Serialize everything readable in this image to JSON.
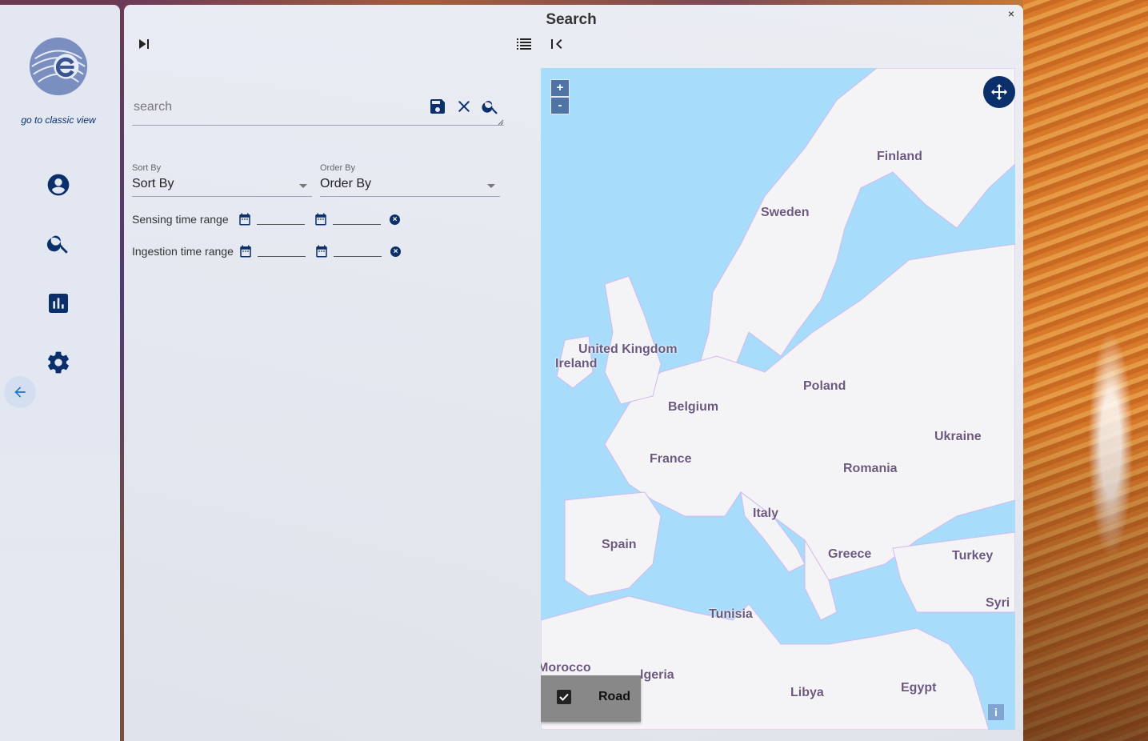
{
  "sidebar": {
    "classic_link": "go to classic view",
    "nav_items": [
      {
        "name": "account",
        "icon": "account-circle-icon"
      },
      {
        "name": "search",
        "icon": "search-icon"
      },
      {
        "name": "statistics",
        "icon": "bar-chart-icon"
      },
      {
        "name": "settings",
        "icon": "gear-icon"
      }
    ],
    "back_icon": "arrow-left-icon"
  },
  "panel": {
    "title": "Search",
    "close_label": "×"
  },
  "search": {
    "placeholder": "search",
    "value": ""
  },
  "sort": {
    "sort_by_label": "Sort By",
    "sort_by_value": "Sort By",
    "order_by_label": "Order By",
    "order_by_value": "Order By"
  },
  "ranges": {
    "sensing_label": "Sensing time range",
    "ingestion_label": "Ingestion time range"
  },
  "map": {
    "zoom_in": "+",
    "zoom_out": "-",
    "labels": {
      "finland": "Finland",
      "sweden": "Sweden",
      "uk": "United Kingdom",
      "ireland": "Ireland",
      "poland": "Poland",
      "belgium": "Belgium",
      "ukraine": "Ukraine",
      "france": "France",
      "romania": "Romania",
      "italy": "Italy",
      "spain": "Spain",
      "greece": "Greece",
      "turkey": "Turkey",
      "syria": "Syri",
      "tunisia": "Tunisia",
      "morocco": "Morocco",
      "algeria": "lgeria",
      "libya": "Libya",
      "egypt": "Egypt"
    },
    "layer_label": "Road",
    "layer_checked": true,
    "info_label": "i"
  },
  "colors": {
    "accent": "#0a2f6b",
    "water": "#a8dcfb",
    "land": "#f4f3f6",
    "border": "#d3b9ee"
  }
}
